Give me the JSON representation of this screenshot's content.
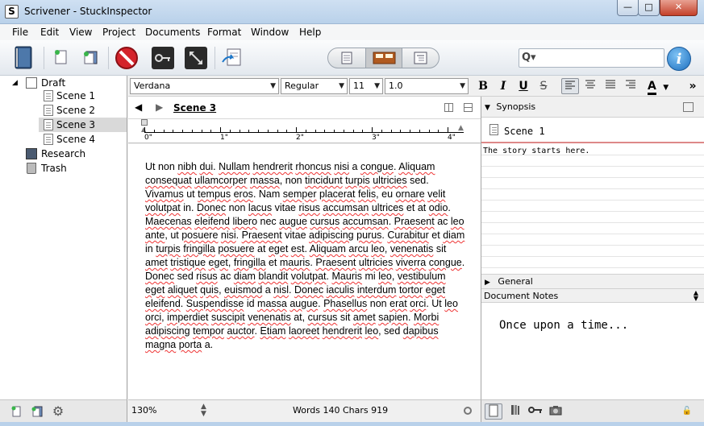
{
  "window": {
    "title": "Scrivener - StuckInspector",
    "min": "—",
    "max": "□",
    "close": "✕"
  },
  "menu": [
    "File",
    "Edit",
    "View",
    "Project",
    "Documents",
    "Format",
    "Window",
    "Help"
  ],
  "toolbar": {
    "icons": [
      "binder-icon",
      "new-document-icon",
      "new-folder-icon",
      "no-entry-icon",
      "keywords-icon",
      "fullscreen-icon",
      "compile-icon"
    ],
    "search_glyph": "Q▾",
    "info": "i"
  },
  "binder": {
    "items": [
      {
        "label": "Draft",
        "level": 0,
        "type": "folder",
        "expanded": true
      },
      {
        "label": "Scene 1",
        "level": 1,
        "type": "doc"
      },
      {
        "label": "Scene 2",
        "level": 1,
        "type": "doc"
      },
      {
        "label": "Scene 3",
        "level": 1,
        "type": "doc",
        "selected": true
      },
      {
        "label": "Scene 4",
        "level": 1,
        "type": "doc"
      },
      {
        "label": "Research",
        "level": 0,
        "type": "research"
      },
      {
        "label": "Trash",
        "level": 0,
        "type": "trash"
      }
    ]
  },
  "format": {
    "font": "Verdana",
    "style": "Regular",
    "size": "11",
    "spacing": "1.0",
    "bold": "B",
    "italic": "I",
    "underline": "U",
    "strike": "S",
    "color_label": "A",
    "more": "»"
  },
  "editor": {
    "title": "Scene 3",
    "ruler_labels": [
      "0\"",
      "1\"",
      "2\"",
      "3\"",
      "4\""
    ],
    "text": "Ut non nibh dui. Nullam hendrerit rhoncus nisi a congue. Aliquam consequat ullamcorper massa, non tincidunt turpis ultricies sed. Vivamus ut tempus eros. Nam semper placerat felis, eu ornare velit volutpat in. Donec non lacus vitae risus accumsan ultrices et at odio. Maecenas eleifend libero nec augue cursus accumsan. Praesent ac leo ante, ut posuere nisi. Praesent vitae adipiscing purus. Curabitur et diam in turpis fringilla posuere at eget est. Aliquam arcu leo, venenatis sit amet tristique eget, fringilla et mauris. Praesent ultricies viverra congue. Donec sed risus ac diam blandit volutpat. Mauris mi leo, vestibulum eget aliquet quis, euismod a nisl. Donec iaculis interdum tortor eget eleifend. Suspendisse id massa augue. Phasellus non erat orci. Ut leo orci, imperdiet suscipit venenatis at, cursus sit amet sapien. Morbi adipiscing tempor auctor. Etiam laoreet hendrerit leo, sed dapibus magna porta a.",
    "zoom": "130%",
    "word_count": "Words 140 Chars 919"
  },
  "inspector": {
    "synopsis_label": "Synopsis",
    "synopsis_title": "Scene 1",
    "synopsis_text": "The story starts here.",
    "general_label": "General",
    "notes_label": "Document Notes",
    "notes_text": "Once upon a time..."
  },
  "colors": {
    "spell_underline": "#e33",
    "titlebar": "#b9d1ea",
    "info_blue": "#1c6fbf"
  }
}
